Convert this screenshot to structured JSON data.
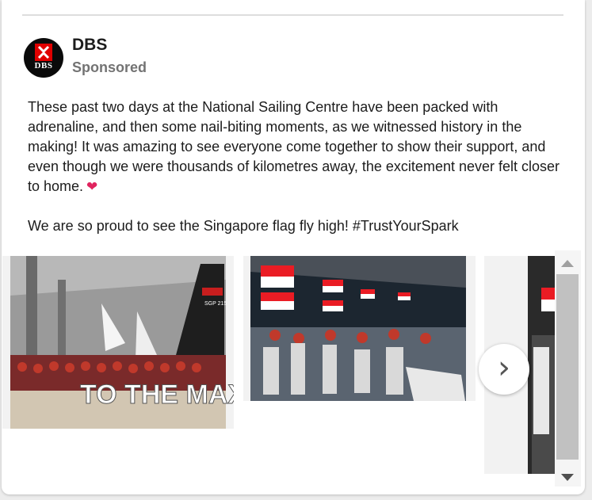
{
  "post": {
    "author": "DBS",
    "sponsored_label": "Sponsored",
    "avatar_logo_text": "DBS",
    "paragraphs": [
      "These past two days at the National Sailing Centre have been packed with adrenaline, and then some nail-biting moments, as we witnessed history in the making! It was amazing to see everyone come together to show their support, and even though we were thousands of kilometres away, the excitement never felt closer to home.",
      "We are so proud to see the Singapore flag fly high! #TrustYourSpark"
    ],
    "emoji": "❤",
    "brand_color": "#e00000"
  },
  "carousel": {
    "slides": [
      {
        "image": "group-photo-to-the-max",
        "banner_text": "TO THE MAX",
        "sail_text": "SGP 215"
      },
      {
        "image": "crowd-with-singapore-flags"
      },
      {
        "image": "supporters-partial"
      }
    ],
    "next_icon": "chevron-right-icon"
  },
  "scrollbar": {
    "up_icon": "triangle-up-icon",
    "down_icon": "triangle-down-icon"
  }
}
